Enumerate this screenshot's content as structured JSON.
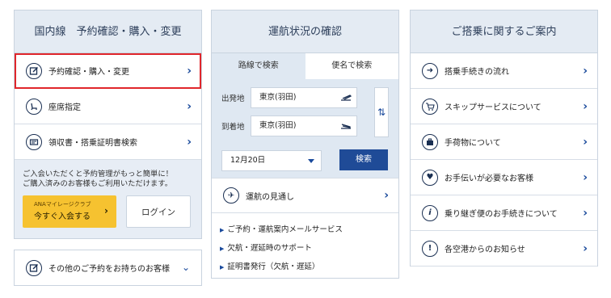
{
  "domestic": {
    "title": "国内線　予約確認・購入・変更",
    "items": [
      {
        "label": "予約確認・購入・変更",
        "icon": "pencil-box-icon"
      },
      {
        "label": "座席指定",
        "icon": "seat-icon"
      },
      {
        "label": "領収書・搭乗証明書検索",
        "icon": "receipt-icon"
      }
    ],
    "info_text_1": "ご入会いただくと予約管理がもっと簡単に！",
    "info_text_2": "ご購入済みのお客様もご利用いただけます。",
    "join_small": "ANAマイレージクラブ",
    "join_big": "今すぐ入会する",
    "login": "ログイン",
    "other": "その他のご予約をお持ちのお客様"
  },
  "status": {
    "title": "運航状況の確認",
    "tab_route": "路線で検索",
    "tab_flight": "便名で検索",
    "from_label": "出発地",
    "from_value": "東京(羽田)",
    "to_label": "到着地",
    "to_value": "東京(羽田)",
    "date_value": "12月20日",
    "search_label": "検索",
    "outlook": "運航の見通し",
    "links": [
      "ご予約・運航案内メールサービス",
      "欠航・遅延時のサポート",
      "証明書発行（欠航・遅延）"
    ]
  },
  "boarding": {
    "title": "ご搭乗に関するご案内",
    "items": [
      {
        "label": "搭乗手続きの流れ",
        "icon": "arrow-circle-icon"
      },
      {
        "label": "スキップサービスについて",
        "icon": "cart-icon"
      },
      {
        "label": "手荷物について",
        "icon": "baggage-icon"
      },
      {
        "label": "お手伝いが必要なお客様",
        "icon": "heart-icon"
      },
      {
        "label": "乗り継ぎ便のお手続きについて",
        "icon": "info-icon"
      },
      {
        "label": "各空港からのお知らせ",
        "icon": "exclamation-icon"
      }
    ]
  },
  "colors": {
    "accent": "#1f4b97",
    "highlight": "#e0262b",
    "join_button": "#f6c230"
  }
}
